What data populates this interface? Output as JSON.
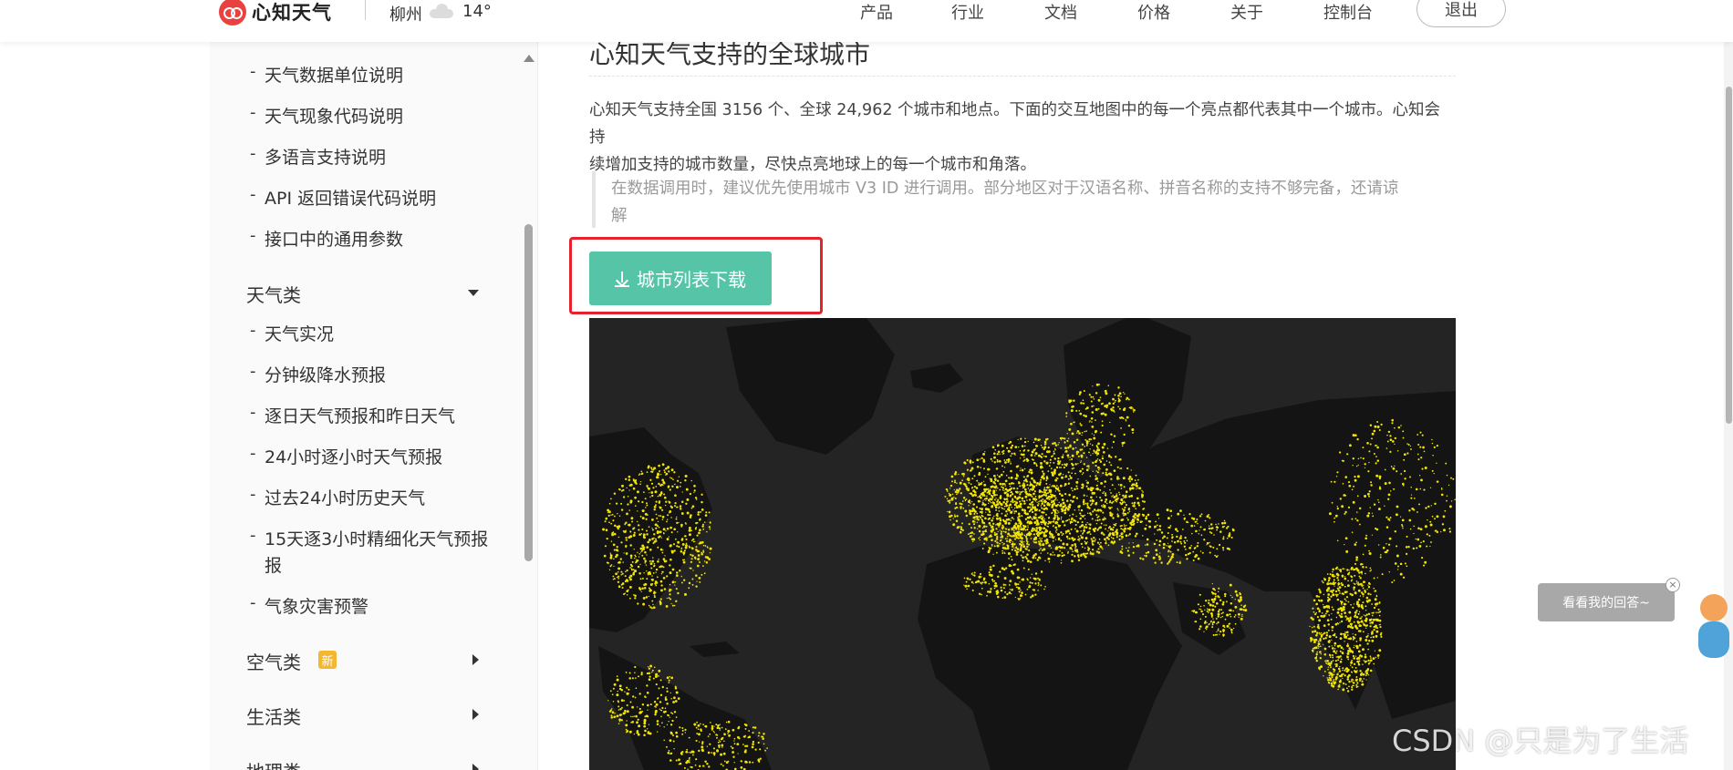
{
  "header": {
    "logo_text": "心知天气",
    "city": "柳州",
    "weather_icon": "cloud-icon",
    "temperature": "14°",
    "nav": [
      "产品",
      "行业",
      "文档",
      "价格",
      "关于",
      "控制台"
    ],
    "logout_label": "退出"
  },
  "sidebar": {
    "sections": [
      {
        "items": [
          "天气数据单位说明",
          "天气现象代码说明",
          "多语言支持说明",
          "API 返回错误代码说明",
          "接口中的通用参数"
        ]
      },
      {
        "label": "天气类",
        "expanded": true,
        "items": [
          "天气实况",
          "分钟级降水预报",
          "逐日天气预报和昨日天气",
          "24小时逐小时天气预报",
          "过去24小时历史天气",
          "15天逐3小时精细化天气预报",
          "报",
          "气象灾害预警"
        ]
      },
      {
        "label": "空气类",
        "badge": "新",
        "expanded": false
      },
      {
        "label": "生活类",
        "expanded": false
      },
      {
        "label": "地理类",
        "expanded": false
      }
    ]
  },
  "main": {
    "title": "心知天气支持的全球城市",
    "paragraph_line1": "心知天气支持全国 3156 个、全球 24,962 个城市和地点。下面的交互地图中的每一个亮点都代表其中一个城市。心知会持",
    "paragraph_line2": "续增加支持的城市数量，尽快点亮地球上的每一个城市和角落。",
    "note_line1": "在数据调用时，建议优先使用城市 V3 ID 进行调用。部分地区对于汉语名称、拼音名称的支持不够完备，还请谅",
    "note_line2": "解",
    "download_label": "城市列表下载",
    "download_icon": "download-icon"
  },
  "float": {
    "label": "看看我的回答~",
    "close": "×"
  },
  "watermark": "CSDN @只是为了生活",
  "colors": {
    "accent": "#56c4a6",
    "highlight": "#e8212e",
    "map_bg": "#242424",
    "city_dot": "#f2e600"
  }
}
